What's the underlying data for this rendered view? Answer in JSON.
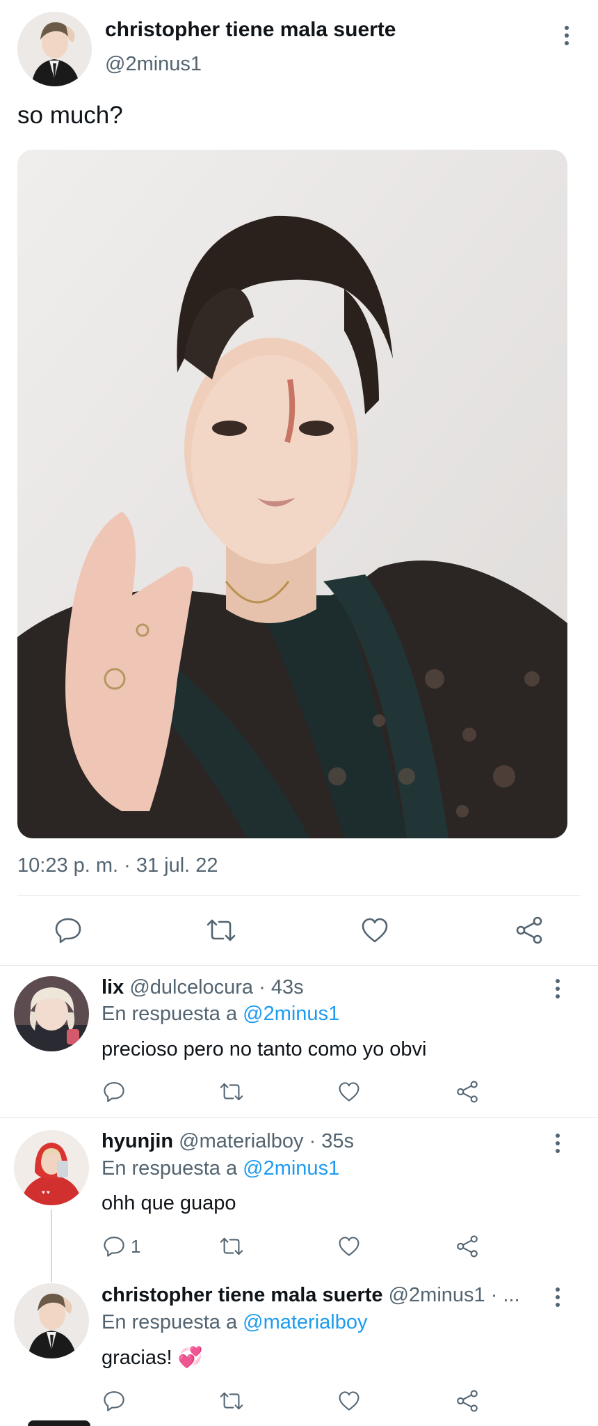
{
  "main_tweet": {
    "display_name": "christopher tiene mala suerte",
    "handle": "@2minus1",
    "text": "so much?",
    "timestamp": "10:23 p. m. · 31 jul. 22"
  },
  "replies": [
    {
      "display_name": "lix",
      "handle_time": "@dulcelocura · 43s",
      "reply_prefix": "En respuesta a",
      "reply_to": "@2minus1",
      "text": "precioso pero no tanto como yo obvi",
      "reply_count": ""
    },
    {
      "display_name": "hyunjin",
      "handle_time": "@materialboy · 35s",
      "reply_prefix": "En respuesta a",
      "reply_to": "@2minus1",
      "text": "ohh que guapo",
      "reply_count": "1"
    },
    {
      "display_name": "christopher tiene mala suerte",
      "handle_time": "@2minus1 · ...",
      "reply_prefix": "En respuesta a",
      "reply_to": "@materialboy",
      "text": "gracias! 💞",
      "reply_count": ""
    }
  ],
  "colors": {
    "accent": "#1d9bf0",
    "text": "#0f1419",
    "muted": "#536471",
    "divider": "#e1e8ed"
  },
  "icons": [
    "more-icon",
    "reply-icon",
    "retweet-icon",
    "like-icon",
    "share-icon"
  ]
}
